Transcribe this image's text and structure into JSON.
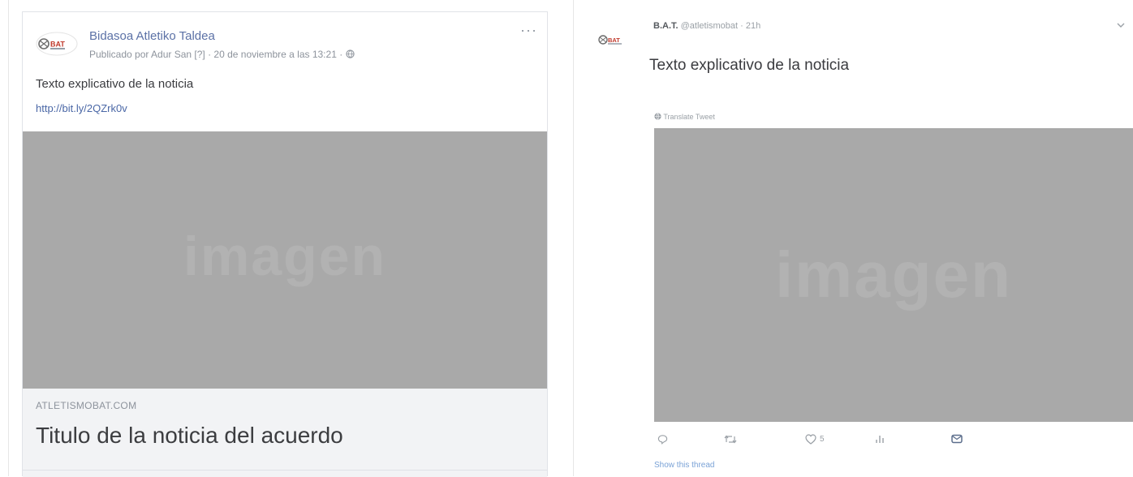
{
  "facebook": {
    "page_name": "Bidasoa Atletiko Taldea",
    "meta": "Publicado por Adur San [?] · 20 de noviembre a las 13:21 · ",
    "post_text": "Texto explicativo de la noticia",
    "link": "http://bit.ly/2QZrk0v",
    "image_label": "imagen",
    "domain": "ATLETISMOBAT.COM",
    "headline": "Titulo de la noticia del acuerdo",
    "more_glyph": "···",
    "icons": [
      "bat-logo",
      "globe-icon",
      "more-icon"
    ]
  },
  "twitter": {
    "name": "B.A.T.",
    "handle_time": " @atletismobat · 21h",
    "tweet_text": "Texto explicativo de la noticia",
    "translate": "Translate Tweet",
    "image_label": "imagen",
    "like_count": "5",
    "show_thread": "Show this thread",
    "icons": [
      "bat-logo",
      "chevron-down-icon",
      "reply-icon",
      "retweet-icon",
      "like-icon",
      "analytics-icon",
      "direct-message-icon",
      "globe-icon"
    ]
  },
  "colors": {
    "image_placeholder": "#a9a9a9",
    "fb_link": "#4a67a6",
    "fb_name": "#5b71a6",
    "tw_link": "#7aa2d6"
  }
}
